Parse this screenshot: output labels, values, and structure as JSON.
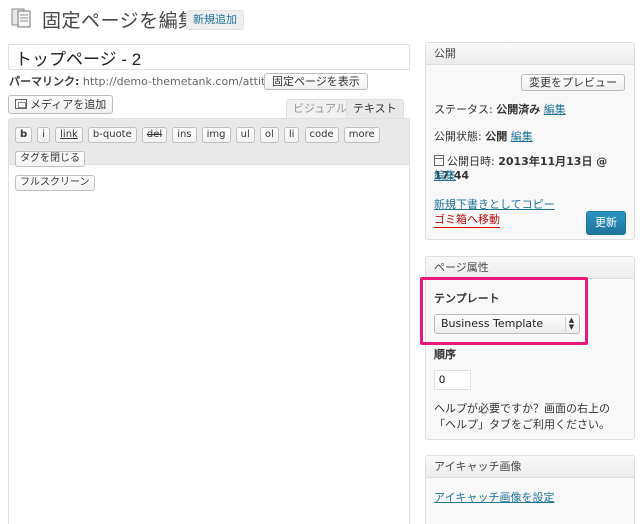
{
  "header": {
    "title": "固定ページを編集",
    "add_new": "新規追加"
  },
  "post": {
    "title_value": "トップページ - 2",
    "permalink_label": "パーマリンク:",
    "permalink_url": "http://demo-themetank.com/attitude/",
    "view_page_label": "固定ページを表示"
  },
  "editor": {
    "add_media_label": "メディアを追加",
    "tabs": {
      "visual": "ビジュアル",
      "text": "テキスト"
    },
    "quicktags": [
      "b",
      "i",
      "link",
      "b-quote",
      "del",
      "ins",
      "img",
      "ul",
      "ol",
      "li",
      "code",
      "more",
      "タグを閉じる"
    ],
    "fullscreen_label": "フルスクリーン"
  },
  "publish": {
    "title": "公開",
    "preview_label": "変更をプレビュー",
    "status_label": "ステータス:",
    "status_value": "公開済み",
    "visibility_label": "公開状態:",
    "visibility_value": "公開",
    "date_label": "公開日時:",
    "date_value": "2013年11月13日 @ 17:44",
    "edit_label": "編集",
    "copy_draft_label": "新規下書きとしてコピー",
    "trash_label": "ゴミ箱へ移動",
    "update_label": "更新"
  },
  "page_attributes": {
    "title": "ページ属性",
    "template_label": "テンプレート",
    "template_value": "Business Template",
    "order_label": "順序",
    "order_value": "0",
    "help_text": "ヘルプが必要ですか？画面の右上の「ヘルプ」タブをご利用ください。"
  },
  "featured_image": {
    "title": "アイキャッチ画像",
    "set_label": "アイキャッチ画像を設定"
  },
  "colors": {
    "link": "#21759b",
    "trash": "#bc0b0b",
    "highlight": "#e8197d",
    "primary_button": "#21759b"
  },
  "icons": [
    "pages-icon",
    "media-icon",
    "calendar-icon",
    "select-arrows-icon"
  ]
}
